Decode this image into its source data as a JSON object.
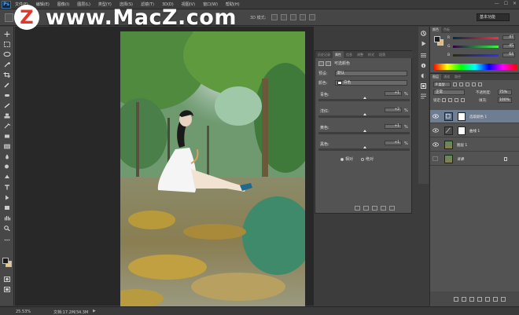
{
  "app": {
    "logo": "Ps"
  },
  "menubar": {
    "items": [
      "文件(F)",
      "编辑(E)",
      "图像(I)",
      "图层(L)",
      "类型(Y)",
      "选择(S)",
      "滤镜(T)",
      "3D(D)",
      "视图(V)",
      "窗口(W)",
      "帮助(H)"
    ],
    "window_controls": [
      "—",
      "☐",
      "✕"
    ]
  },
  "optionsbar": {
    "mode_label": "3D 模式:",
    "workspace": "基本功能"
  },
  "watermark": {
    "logo_letter": "Z",
    "text": "www.MacZ.com"
  },
  "statusbar": {
    "zoom": "25.53%",
    "doc_info": "文档:17.2M/34.3M",
    "arrow": "▶"
  },
  "properties": {
    "tabs": [
      "历史记录",
      "属性",
      "信息",
      "调整",
      "样式",
      "段落"
    ],
    "active_tab": 1,
    "title": "可选颜色",
    "preset_label": "预设:",
    "preset_value": "默认",
    "colors_label": "颜色:",
    "colors_value": "白色",
    "sliders": [
      {
        "label": "青色:",
        "value": "+1",
        "unit": "%",
        "position": 0.505
      },
      {
        "label": "洋红:",
        "value": "+2",
        "unit": "%",
        "position": 0.51
      },
      {
        "label": "黄色:",
        "value": "+1",
        "unit": "%",
        "position": 0.505
      },
      {
        "label": "黑色:",
        "value": "+1",
        "unit": "%",
        "position": 0.505
      }
    ],
    "method": {
      "relative": "相对",
      "absolute": "绝对",
      "selected": "relative"
    }
  },
  "color_panel": {
    "tabs": [
      "颜色",
      "色板"
    ],
    "r": {
      "label": "R",
      "value": "47"
    },
    "g": {
      "label": "G",
      "value": "45"
    },
    "b": {
      "label": "B",
      "value": "64"
    }
  },
  "layers": {
    "tabs": [
      "图层",
      "通道",
      "路径"
    ],
    "filter": "P 类型",
    "blend_mode": "正常",
    "opacity_label": "不透明度:",
    "opacity_value": "75%",
    "lock_label": "锁定:",
    "fill_label": "填充:",
    "fill_value": "100%",
    "items": [
      {
        "name": "选取颜色 1",
        "type": "adjustment",
        "selected": true,
        "visible": true
      },
      {
        "name": "曲线 1",
        "type": "adjustment",
        "selected": false,
        "visible": true
      },
      {
        "name": "图层 1",
        "type": "pixel",
        "selected": false,
        "visible": true
      },
      {
        "name": "背景",
        "type": "background",
        "selected": false,
        "visible": false
      }
    ]
  },
  "colors": {
    "ui_dark": "#3c3c3c",
    "panel": "#535353",
    "selected_layer": "#6f7d92",
    "watermark_red": "#e8352b"
  }
}
